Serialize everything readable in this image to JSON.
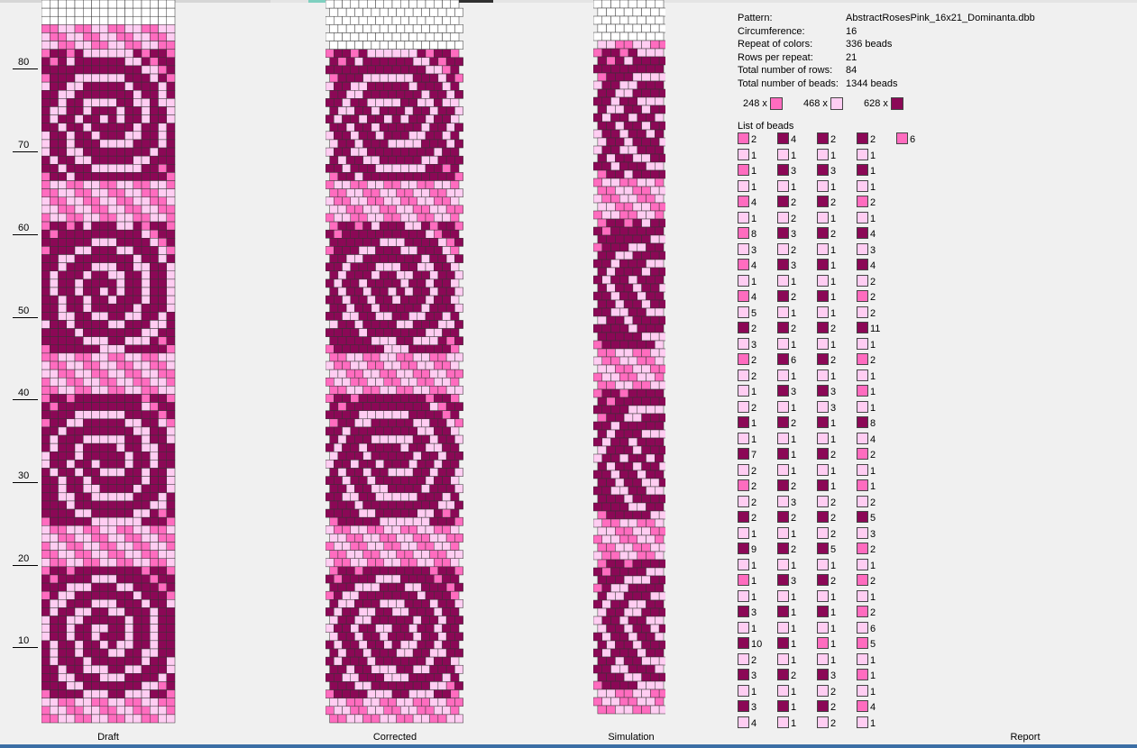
{
  "palette": {
    "0": "#ffcdf2",
    "1": "#ff6cbf",
    "2": "#8b0856",
    "blank": "#ffffff"
  },
  "axis": {
    "rows": [
      10,
      20,
      30,
      40,
      50,
      60,
      70,
      80
    ]
  },
  "panels": {
    "draft": {
      "label": "Draft"
    },
    "corrected": {
      "label": "Corrected"
    },
    "simulation": {
      "label": "Simulation"
    },
    "report": {
      "label": "Report"
    }
  },
  "report": {
    "pattern_label": "Pattern:",
    "pattern_value": "AbstractRosesPink_16x21_Dominanta.dbb",
    "circumference_label": "Circumference:",
    "circumference_value": "16",
    "repeat_label": "Repeat of colors:",
    "repeat_value": "336 beads",
    "rows_per_repeat_label": "Rows per repeat:",
    "rows_per_repeat_value": "21",
    "total_rows_label": "Total number of rows:",
    "total_rows_value": "84",
    "total_beads_label": "Total number of beads:",
    "total_beads_value": "1344 beads",
    "tallies": [
      {
        "text": "248 x",
        "color": "1"
      },
      {
        "text": "468 x",
        "color": "0"
      },
      {
        "text": "628 x",
        "color": "2"
      }
    ],
    "list_title": "List of beads"
  },
  "bead_list": {
    "columns": [
      [
        [
          "1",
          "2"
        ],
        [
          "0",
          "1"
        ],
        [
          "1",
          "1"
        ],
        [
          "0",
          "1"
        ],
        [
          "1",
          "4"
        ],
        [
          "0",
          "1"
        ],
        [
          "1",
          "8"
        ],
        [
          "0",
          "3"
        ],
        [
          "1",
          "4"
        ],
        [
          "0",
          "1"
        ],
        [
          "1",
          "4"
        ],
        [
          "0",
          "5"
        ],
        [
          "2",
          "2"
        ],
        [
          "0",
          "3"
        ],
        [
          "1",
          "2"
        ],
        [
          "0",
          "2"
        ],
        [
          "0",
          "1"
        ],
        [
          "0",
          "2"
        ],
        [
          "2",
          "1"
        ],
        [
          "0",
          "1"
        ],
        [
          "2",
          "7"
        ],
        [
          "0",
          "2"
        ],
        [
          "1",
          "2"
        ],
        [
          "0",
          "2"
        ],
        [
          "2",
          "2"
        ],
        [
          "0",
          "1"
        ],
        [
          "2",
          "9"
        ],
        [
          "0",
          "1"
        ],
        [
          "1",
          "1"
        ],
        [
          "0",
          "1"
        ],
        [
          "2",
          "3"
        ],
        [
          "0",
          "1"
        ],
        [
          "2",
          "10"
        ],
        [
          "0",
          "2"
        ],
        [
          "2",
          "3"
        ],
        [
          "0",
          "1"
        ],
        [
          "2",
          "3"
        ],
        [
          "0",
          "4"
        ]
      ],
      [
        [
          "2",
          "4"
        ],
        [
          "0",
          "1"
        ],
        [
          "2",
          "3"
        ],
        [
          "0",
          "1"
        ],
        [
          "2",
          "2"
        ],
        [
          "0",
          "2"
        ],
        [
          "2",
          "3"
        ],
        [
          "0",
          "2"
        ],
        [
          "2",
          "3"
        ],
        [
          "0",
          "1"
        ],
        [
          "2",
          "2"
        ],
        [
          "0",
          "1"
        ],
        [
          "2",
          "2"
        ],
        [
          "0",
          "1"
        ],
        [
          "2",
          "6"
        ],
        [
          "0",
          "1"
        ],
        [
          "2",
          "3"
        ],
        [
          "0",
          "1"
        ],
        [
          "2",
          "2"
        ],
        [
          "0",
          "1"
        ],
        [
          "2",
          "1"
        ],
        [
          "0",
          "1"
        ],
        [
          "2",
          "2"
        ],
        [
          "0",
          "3"
        ],
        [
          "2",
          "2"
        ],
        [
          "0",
          "1"
        ],
        [
          "2",
          "2"
        ],
        [
          "0",
          "1"
        ],
        [
          "2",
          "3"
        ],
        [
          "0",
          "1"
        ],
        [
          "2",
          "1"
        ],
        [
          "0",
          "1"
        ],
        [
          "2",
          "1"
        ],
        [
          "0",
          "1"
        ],
        [
          "2",
          "2"
        ],
        [
          "0",
          "1"
        ],
        [
          "2",
          "1"
        ],
        [
          "0",
          "1"
        ]
      ],
      [
        [
          "2",
          "2"
        ],
        [
          "0",
          "1"
        ],
        [
          "2",
          "3"
        ],
        [
          "0",
          "1"
        ],
        [
          "2",
          "2"
        ],
        [
          "0",
          "1"
        ],
        [
          "2",
          "2"
        ],
        [
          "0",
          "1"
        ],
        [
          "2",
          "1"
        ],
        [
          "0",
          "1"
        ],
        [
          "2",
          "1"
        ],
        [
          "0",
          "1"
        ],
        [
          "2",
          "2"
        ],
        [
          "0",
          "1"
        ],
        [
          "2",
          "2"
        ],
        [
          "0",
          "1"
        ],
        [
          "2",
          "3"
        ],
        [
          "0",
          "3"
        ],
        [
          "2",
          "1"
        ],
        [
          "0",
          "1"
        ],
        [
          "2",
          "2"
        ],
        [
          "0",
          "1"
        ],
        [
          "2",
          "1"
        ],
        [
          "0",
          "2"
        ],
        [
          "2",
          "2"
        ],
        [
          "0",
          "2"
        ],
        [
          "2",
          "5"
        ],
        [
          "0",
          "1"
        ],
        [
          "2",
          "2"
        ],
        [
          "0",
          "1"
        ],
        [
          "2",
          "1"
        ],
        [
          "0",
          "1"
        ],
        [
          "1",
          "1"
        ],
        [
          "0",
          "1"
        ],
        [
          "2",
          "3"
        ],
        [
          "0",
          "2"
        ],
        [
          "2",
          "2"
        ],
        [
          "0",
          "2"
        ]
      ],
      [
        [
          "2",
          "2"
        ],
        [
          "0",
          "1"
        ],
        [
          "2",
          "1"
        ],
        [
          "0",
          "1"
        ],
        [
          "1",
          "2"
        ],
        [
          "0",
          "1"
        ],
        [
          "2",
          "4"
        ],
        [
          "0",
          "3"
        ],
        [
          "2",
          "4"
        ],
        [
          "0",
          "2"
        ],
        [
          "1",
          "2"
        ],
        [
          "0",
          "2"
        ],
        [
          "2",
          "11"
        ],
        [
          "0",
          "1"
        ],
        [
          "1",
          "2"
        ],
        [
          "0",
          "1"
        ],
        [
          "1",
          "1"
        ],
        [
          "0",
          "1"
        ],
        [
          "2",
          "8"
        ],
        [
          "0",
          "4"
        ],
        [
          "1",
          "2"
        ],
        [
          "0",
          "1"
        ],
        [
          "1",
          "1"
        ],
        [
          "0",
          "2"
        ],
        [
          "2",
          "5"
        ],
        [
          "0",
          "3"
        ],
        [
          "1",
          "2"
        ],
        [
          "0",
          "1"
        ],
        [
          "1",
          "2"
        ],
        [
          "0",
          "1"
        ],
        [
          "1",
          "2"
        ],
        [
          "0",
          "6"
        ],
        [
          "1",
          "5"
        ],
        [
          "0",
          "1"
        ],
        [
          "1",
          "1"
        ],
        [
          "0",
          "1"
        ],
        [
          "1",
          "4"
        ],
        [
          "0",
          "1"
        ]
      ],
      [
        [
          "1",
          "6"
        ]
      ]
    ]
  }
}
